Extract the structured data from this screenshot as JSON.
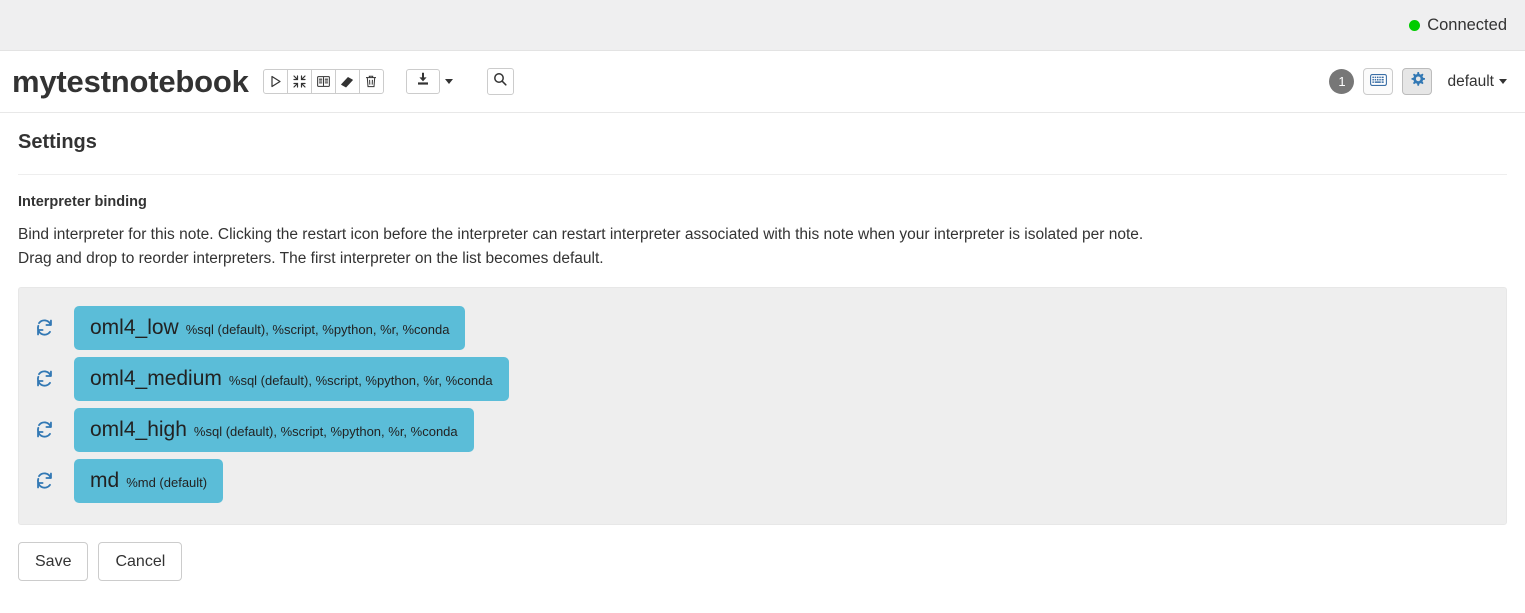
{
  "status_bar": {
    "connection_label": "Connected",
    "connection_color": "#00cc00"
  },
  "header": {
    "notebook_title": "mytestnotebook",
    "toolbar": [
      {
        "name": "run-all-paragraphs-button",
        "icon": "play-icon"
      },
      {
        "name": "collapse-all-button",
        "icon": "collapse-arrows-icon"
      },
      {
        "name": "show-hide-code-button",
        "icon": "book-icon"
      },
      {
        "name": "clear-output-button",
        "icon": "eraser-icon"
      },
      {
        "name": "delete-notebook-button",
        "icon": "trash-icon"
      }
    ],
    "export_icon": "export-download-icon",
    "export_caret_icon": "caret-down-icon",
    "search_icon": "search-icon",
    "revision_badge": "1",
    "keyboard_shortcuts_icon": "keyboard-icon",
    "settings_icon": "gear-icon",
    "settings_icon_color": "#3278b4",
    "interpreter_select_value": "default",
    "interpreter_select_caret": "caret-down-icon"
  },
  "settings": {
    "title": "Settings",
    "section_label": "Interpreter binding",
    "description_line1": "Bind interpreter for this note. Clicking the restart icon before the interpreter can restart interpreter associated with this note when your interpreter is isolated per note.",
    "description_line2": "Drag and drop to reorder interpreters. The first interpreter on the list becomes default.",
    "pill_color": "#5bbdd8",
    "panel_color": "#eeeeee",
    "restart_icon": "restart-refresh-icon",
    "interpreters": [
      {
        "name": "oml4_low",
        "bindings": "%sql (default), %script, %python, %r, %conda"
      },
      {
        "name": "oml4_medium",
        "bindings": "%sql (default), %script, %python, %r, %conda"
      },
      {
        "name": "oml4_high",
        "bindings": "%sql (default), %script, %python, %r, %conda"
      },
      {
        "name": "md",
        "bindings": "%md (default)"
      }
    ],
    "save_label": "Save",
    "cancel_label": "Cancel"
  }
}
